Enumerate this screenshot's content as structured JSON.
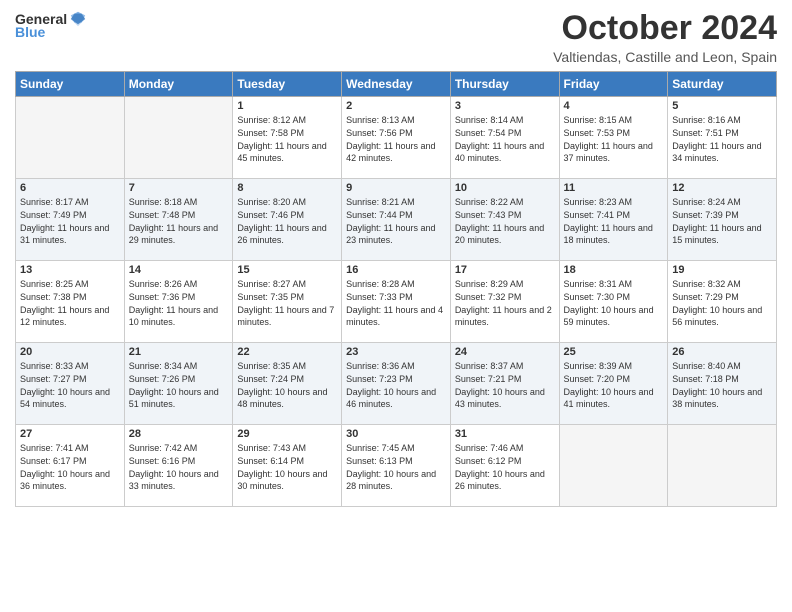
{
  "header": {
    "logo_general": "General",
    "logo_blue": "Blue",
    "month": "October 2024",
    "location": "Valtiendas, Castille and Leon, Spain"
  },
  "days_of_week": [
    "Sunday",
    "Monday",
    "Tuesday",
    "Wednesday",
    "Thursday",
    "Friday",
    "Saturday"
  ],
  "weeks": [
    [
      {
        "day": "",
        "info": ""
      },
      {
        "day": "",
        "info": ""
      },
      {
        "day": "1",
        "info": "Sunrise: 8:12 AM\nSunset: 7:58 PM\nDaylight: 11 hours and 45 minutes."
      },
      {
        "day": "2",
        "info": "Sunrise: 8:13 AM\nSunset: 7:56 PM\nDaylight: 11 hours and 42 minutes."
      },
      {
        "day": "3",
        "info": "Sunrise: 8:14 AM\nSunset: 7:54 PM\nDaylight: 11 hours and 40 minutes."
      },
      {
        "day": "4",
        "info": "Sunrise: 8:15 AM\nSunset: 7:53 PM\nDaylight: 11 hours and 37 minutes."
      },
      {
        "day": "5",
        "info": "Sunrise: 8:16 AM\nSunset: 7:51 PM\nDaylight: 11 hours and 34 minutes."
      }
    ],
    [
      {
        "day": "6",
        "info": "Sunrise: 8:17 AM\nSunset: 7:49 PM\nDaylight: 11 hours and 31 minutes."
      },
      {
        "day": "7",
        "info": "Sunrise: 8:18 AM\nSunset: 7:48 PM\nDaylight: 11 hours and 29 minutes."
      },
      {
        "day": "8",
        "info": "Sunrise: 8:20 AM\nSunset: 7:46 PM\nDaylight: 11 hours and 26 minutes."
      },
      {
        "day": "9",
        "info": "Sunrise: 8:21 AM\nSunset: 7:44 PM\nDaylight: 11 hours and 23 minutes."
      },
      {
        "day": "10",
        "info": "Sunrise: 8:22 AM\nSunset: 7:43 PM\nDaylight: 11 hours and 20 minutes."
      },
      {
        "day": "11",
        "info": "Sunrise: 8:23 AM\nSunset: 7:41 PM\nDaylight: 11 hours and 18 minutes."
      },
      {
        "day": "12",
        "info": "Sunrise: 8:24 AM\nSunset: 7:39 PM\nDaylight: 11 hours and 15 minutes."
      }
    ],
    [
      {
        "day": "13",
        "info": "Sunrise: 8:25 AM\nSunset: 7:38 PM\nDaylight: 11 hours and 12 minutes."
      },
      {
        "day": "14",
        "info": "Sunrise: 8:26 AM\nSunset: 7:36 PM\nDaylight: 11 hours and 10 minutes."
      },
      {
        "day": "15",
        "info": "Sunrise: 8:27 AM\nSunset: 7:35 PM\nDaylight: 11 hours and 7 minutes."
      },
      {
        "day": "16",
        "info": "Sunrise: 8:28 AM\nSunset: 7:33 PM\nDaylight: 11 hours and 4 minutes."
      },
      {
        "day": "17",
        "info": "Sunrise: 8:29 AM\nSunset: 7:32 PM\nDaylight: 11 hours and 2 minutes."
      },
      {
        "day": "18",
        "info": "Sunrise: 8:31 AM\nSunset: 7:30 PM\nDaylight: 10 hours and 59 minutes."
      },
      {
        "day": "19",
        "info": "Sunrise: 8:32 AM\nSunset: 7:29 PM\nDaylight: 10 hours and 56 minutes."
      }
    ],
    [
      {
        "day": "20",
        "info": "Sunrise: 8:33 AM\nSunset: 7:27 PM\nDaylight: 10 hours and 54 minutes."
      },
      {
        "day": "21",
        "info": "Sunrise: 8:34 AM\nSunset: 7:26 PM\nDaylight: 10 hours and 51 minutes."
      },
      {
        "day": "22",
        "info": "Sunrise: 8:35 AM\nSunset: 7:24 PM\nDaylight: 10 hours and 48 minutes."
      },
      {
        "day": "23",
        "info": "Sunrise: 8:36 AM\nSunset: 7:23 PM\nDaylight: 10 hours and 46 minutes."
      },
      {
        "day": "24",
        "info": "Sunrise: 8:37 AM\nSunset: 7:21 PM\nDaylight: 10 hours and 43 minutes."
      },
      {
        "day": "25",
        "info": "Sunrise: 8:39 AM\nSunset: 7:20 PM\nDaylight: 10 hours and 41 minutes."
      },
      {
        "day": "26",
        "info": "Sunrise: 8:40 AM\nSunset: 7:18 PM\nDaylight: 10 hours and 38 minutes."
      }
    ],
    [
      {
        "day": "27",
        "info": "Sunrise: 7:41 AM\nSunset: 6:17 PM\nDaylight: 10 hours and 36 minutes."
      },
      {
        "day": "28",
        "info": "Sunrise: 7:42 AM\nSunset: 6:16 PM\nDaylight: 10 hours and 33 minutes."
      },
      {
        "day": "29",
        "info": "Sunrise: 7:43 AM\nSunset: 6:14 PM\nDaylight: 10 hours and 30 minutes."
      },
      {
        "day": "30",
        "info": "Sunrise: 7:45 AM\nSunset: 6:13 PM\nDaylight: 10 hours and 28 minutes."
      },
      {
        "day": "31",
        "info": "Sunrise: 7:46 AM\nSunset: 6:12 PM\nDaylight: 10 hours and 26 minutes."
      },
      {
        "day": "",
        "info": ""
      },
      {
        "day": "",
        "info": ""
      }
    ]
  ]
}
